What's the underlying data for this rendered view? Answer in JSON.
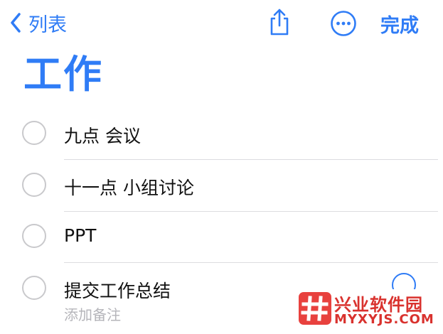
{
  "nav": {
    "back_label": "列表",
    "done_label": "完成"
  },
  "list": {
    "title": "工作"
  },
  "items": [
    {
      "text": "九点 会议",
      "completed": false
    },
    {
      "text": "十一点 小组讨论",
      "completed": false
    },
    {
      "text": "PPT",
      "completed": false
    },
    {
      "text": "提交工作总结",
      "note_placeholder": "添加备注",
      "completed": false
    }
  ],
  "watermark": {
    "name": "兴业软件园",
    "site": "MYXYJS.COM"
  },
  "colors": {
    "accent": "#2f7cf6",
    "divider": "#dcdce0",
    "checkbox_border": "#c9c9cc",
    "placeholder": "#b5b5ba",
    "watermark": "#d9322e"
  },
  "icons": {
    "back": "chevron-left-icon",
    "share": "share-icon",
    "more": "ellipsis-circle-icon",
    "info": "info-icon",
    "watermark_logo": "hash-logo-icon"
  }
}
